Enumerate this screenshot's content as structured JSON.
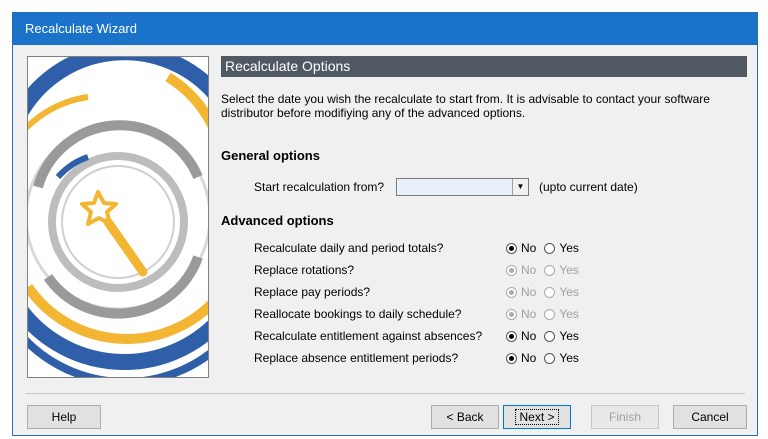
{
  "window": {
    "title": "Recalculate Wizard"
  },
  "header": {
    "title": "Recalculate Options"
  },
  "intro": "Select the date you wish the recalculate to start from. It is advisable to contact your software distributor before modifiying any of the advanced options.",
  "general": {
    "heading": "General options",
    "start_label": "Start recalculation from?",
    "start_value": "",
    "hint": "(upto current date)"
  },
  "advanced": {
    "heading": "Advanced options",
    "options": [
      {
        "label": "Recalculate daily and period totals?",
        "no": "No",
        "yes": "Yes",
        "selected": "No",
        "enabled": true
      },
      {
        "label": "Replace rotations?",
        "no": "No",
        "yes": "Yes",
        "selected": "No",
        "enabled": false
      },
      {
        "label": "Replace pay periods?",
        "no": "No",
        "yes": "Yes",
        "selected": "No",
        "enabled": false
      },
      {
        "label": "Reallocate bookings to daily schedule?",
        "no": "No",
        "yes": "Yes",
        "selected": "No",
        "enabled": false
      },
      {
        "label": "Recalculate entitlement against absences?",
        "no": "No",
        "yes": "Yes",
        "selected": "No",
        "enabled": true
      },
      {
        "label": "Replace absence entitlement periods?",
        "no": "No",
        "yes": "Yes",
        "selected": "No",
        "enabled": true
      }
    ]
  },
  "buttons": {
    "help": "Help",
    "back": "< Back",
    "next": "Next >",
    "finish": "Finish",
    "cancel": "Cancel"
  },
  "colors": {
    "titlebar": "#1a73c8",
    "header_bar": "#505862",
    "accent_blue": "#2f5fa8",
    "accent_yellow": "#f2b632"
  }
}
